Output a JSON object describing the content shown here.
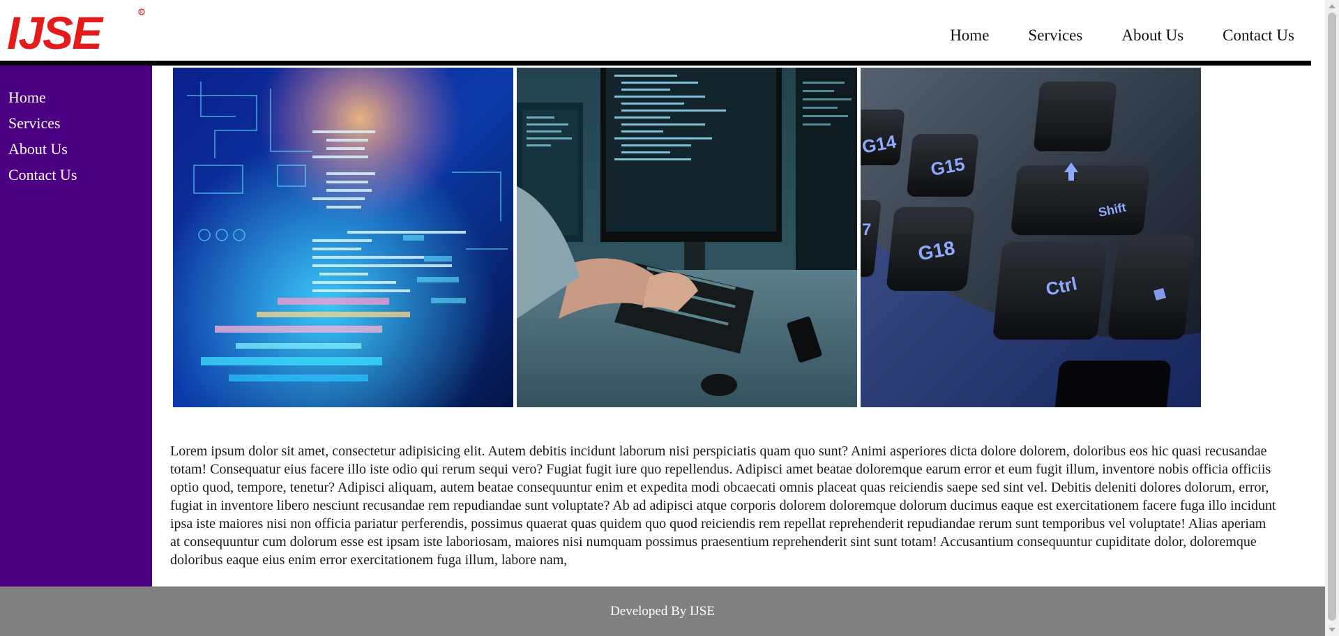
{
  "header": {
    "logo_text": "IJSE",
    "logo_color": "#e41b1b",
    "nav": [
      "Home",
      "Services",
      "About Us",
      "Contact Us"
    ]
  },
  "sidebar": {
    "background": "#4b0082",
    "items": [
      "Home",
      "Services",
      "About Us",
      "Contact Us"
    ]
  },
  "gallery": {
    "images": [
      {
        "name": "code-hologram-photo"
      },
      {
        "name": "developer-at-monitors-photo"
      },
      {
        "name": "keyboard-closeup-photo"
      }
    ],
    "keyboard_keys": [
      "G14",
      "G15",
      "G18",
      "Ctrl",
      "Shift",
      "7"
    ]
  },
  "content": {
    "paragraph": "Lorem ipsum dolor sit amet, consectetur adipisicing elit. Autem debitis incidunt laborum nisi perspiciatis quam quo sunt? Animi asperiores dicta dolore dolorem, doloribus eos hic quasi recusandae totam! Consequatur eius facere illo iste odio qui rerum sequi vero? Fugiat fugit iure quo repellendus. Adipisci amet beatae doloremque earum error et eum fugit illum, inventore nobis officia officiis optio quod, tempore, tenetur? Adipisci aliquam, autem beatae consequuntur enim et expedita modi obcaecati omnis placeat quas reiciendis saepe sed sint vel. Debitis deleniti dolores dolorum, error, fugiat in inventore libero nesciunt recusandae rem repudiandae sunt voluptate? Ab ad adipisci atque corporis dolorem doloremque dolorum ducimus eaque est exercitationem facere fuga illo incidunt ipsa iste maiores nisi non officia pariatur perferendis, possimus quaerat quas quidem quo quod reiciendis rem repellat reprehenderit repudiandae rerum sunt temporibus vel voluptate! Alias aperiam at consequuntur cum dolorum esse est ipsam iste laboriosam, maiores nisi numquam possimus praesentium reprehenderit sint sunt totam! Accusantium consequuntur cupiditate dolor, doloremque doloribus eaque eius enim error exercitationem fuga illum, labore nam,"
  },
  "footer": {
    "text": "Developed By IJSE",
    "background": "#808080"
  }
}
